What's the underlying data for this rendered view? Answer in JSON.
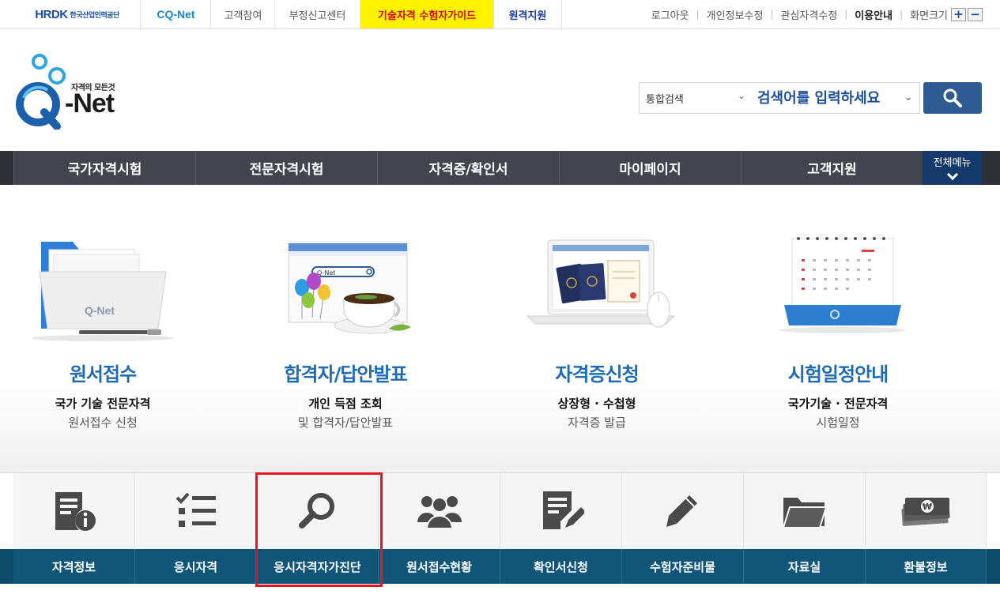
{
  "topbar": {
    "hrdk_mark": "HRDK",
    "hrdk_name": "한국산업인력공단",
    "cqnet_mark": "CQ-Net",
    "links": {
      "customer": "고객참여",
      "report": "부정신고센터",
      "guide": "기술자격 수험자가이드",
      "remote": "원격지원"
    },
    "right": {
      "logout": "로그아웃",
      "edit_info": "개인정보수정",
      "edit_interest": "관심자격수정",
      "usage": "이용안내",
      "screen_size": "화면크기",
      "zoom_in": "+",
      "zoom_out": "−"
    }
  },
  "header": {
    "logo_tagline": "자격의 모든것",
    "logo_text": "-Net",
    "search": {
      "scope": "통합검색",
      "placeholder": "검색어를 입력하세요"
    }
  },
  "gnb": {
    "items": [
      "국가자격시험",
      "전문자격시험",
      "자격증/확인서",
      "마이페이지",
      "고객지원"
    ],
    "all_menu": "전체메뉴"
  },
  "services": [
    {
      "title": "원서접수",
      "desc1": "국가 기술 전문자격",
      "desc2": "원서접수 신청"
    },
    {
      "title": "합격자/답안발표",
      "desc1": "개인 득점 조회",
      "desc2": "및 합격자/답안발표"
    },
    {
      "title": "자격증신청",
      "desc1": "상장형 · 수첩형",
      "desc2": "자격증 발급"
    },
    {
      "title": "시험일정안내",
      "desc1": "국가기술 · 전문자격",
      "desc2": "시험일정"
    }
  ],
  "illustrations": {
    "folder_brand": "Q-Net",
    "browser_search": "Q-Net"
  },
  "quick_menu": [
    {
      "label": "자격정보",
      "icon": "document-info-icon"
    },
    {
      "label": "응시자격",
      "icon": "checklist-icon"
    },
    {
      "label": "응시자격자가진단",
      "icon": "magnifier-icon"
    },
    {
      "label": "원서접수현황",
      "icon": "users-group-icon"
    },
    {
      "label": "확인서신청",
      "icon": "document-edit-icon"
    },
    {
      "label": "수험자준비물",
      "icon": "pencil-icon"
    },
    {
      "label": "자료실",
      "icon": "folder-icon"
    },
    {
      "label": "환불정보",
      "icon": "money-icon"
    }
  ],
  "colors": {
    "brand_blue": "#1f6bb3",
    "gnb_bg": "#42454e",
    "all_menu_bg": "#15396b",
    "quick_label_bg": "#115679",
    "guide_bg": "#fff200",
    "guide_text": "#d6001c",
    "highlight": "#e5161e"
  }
}
